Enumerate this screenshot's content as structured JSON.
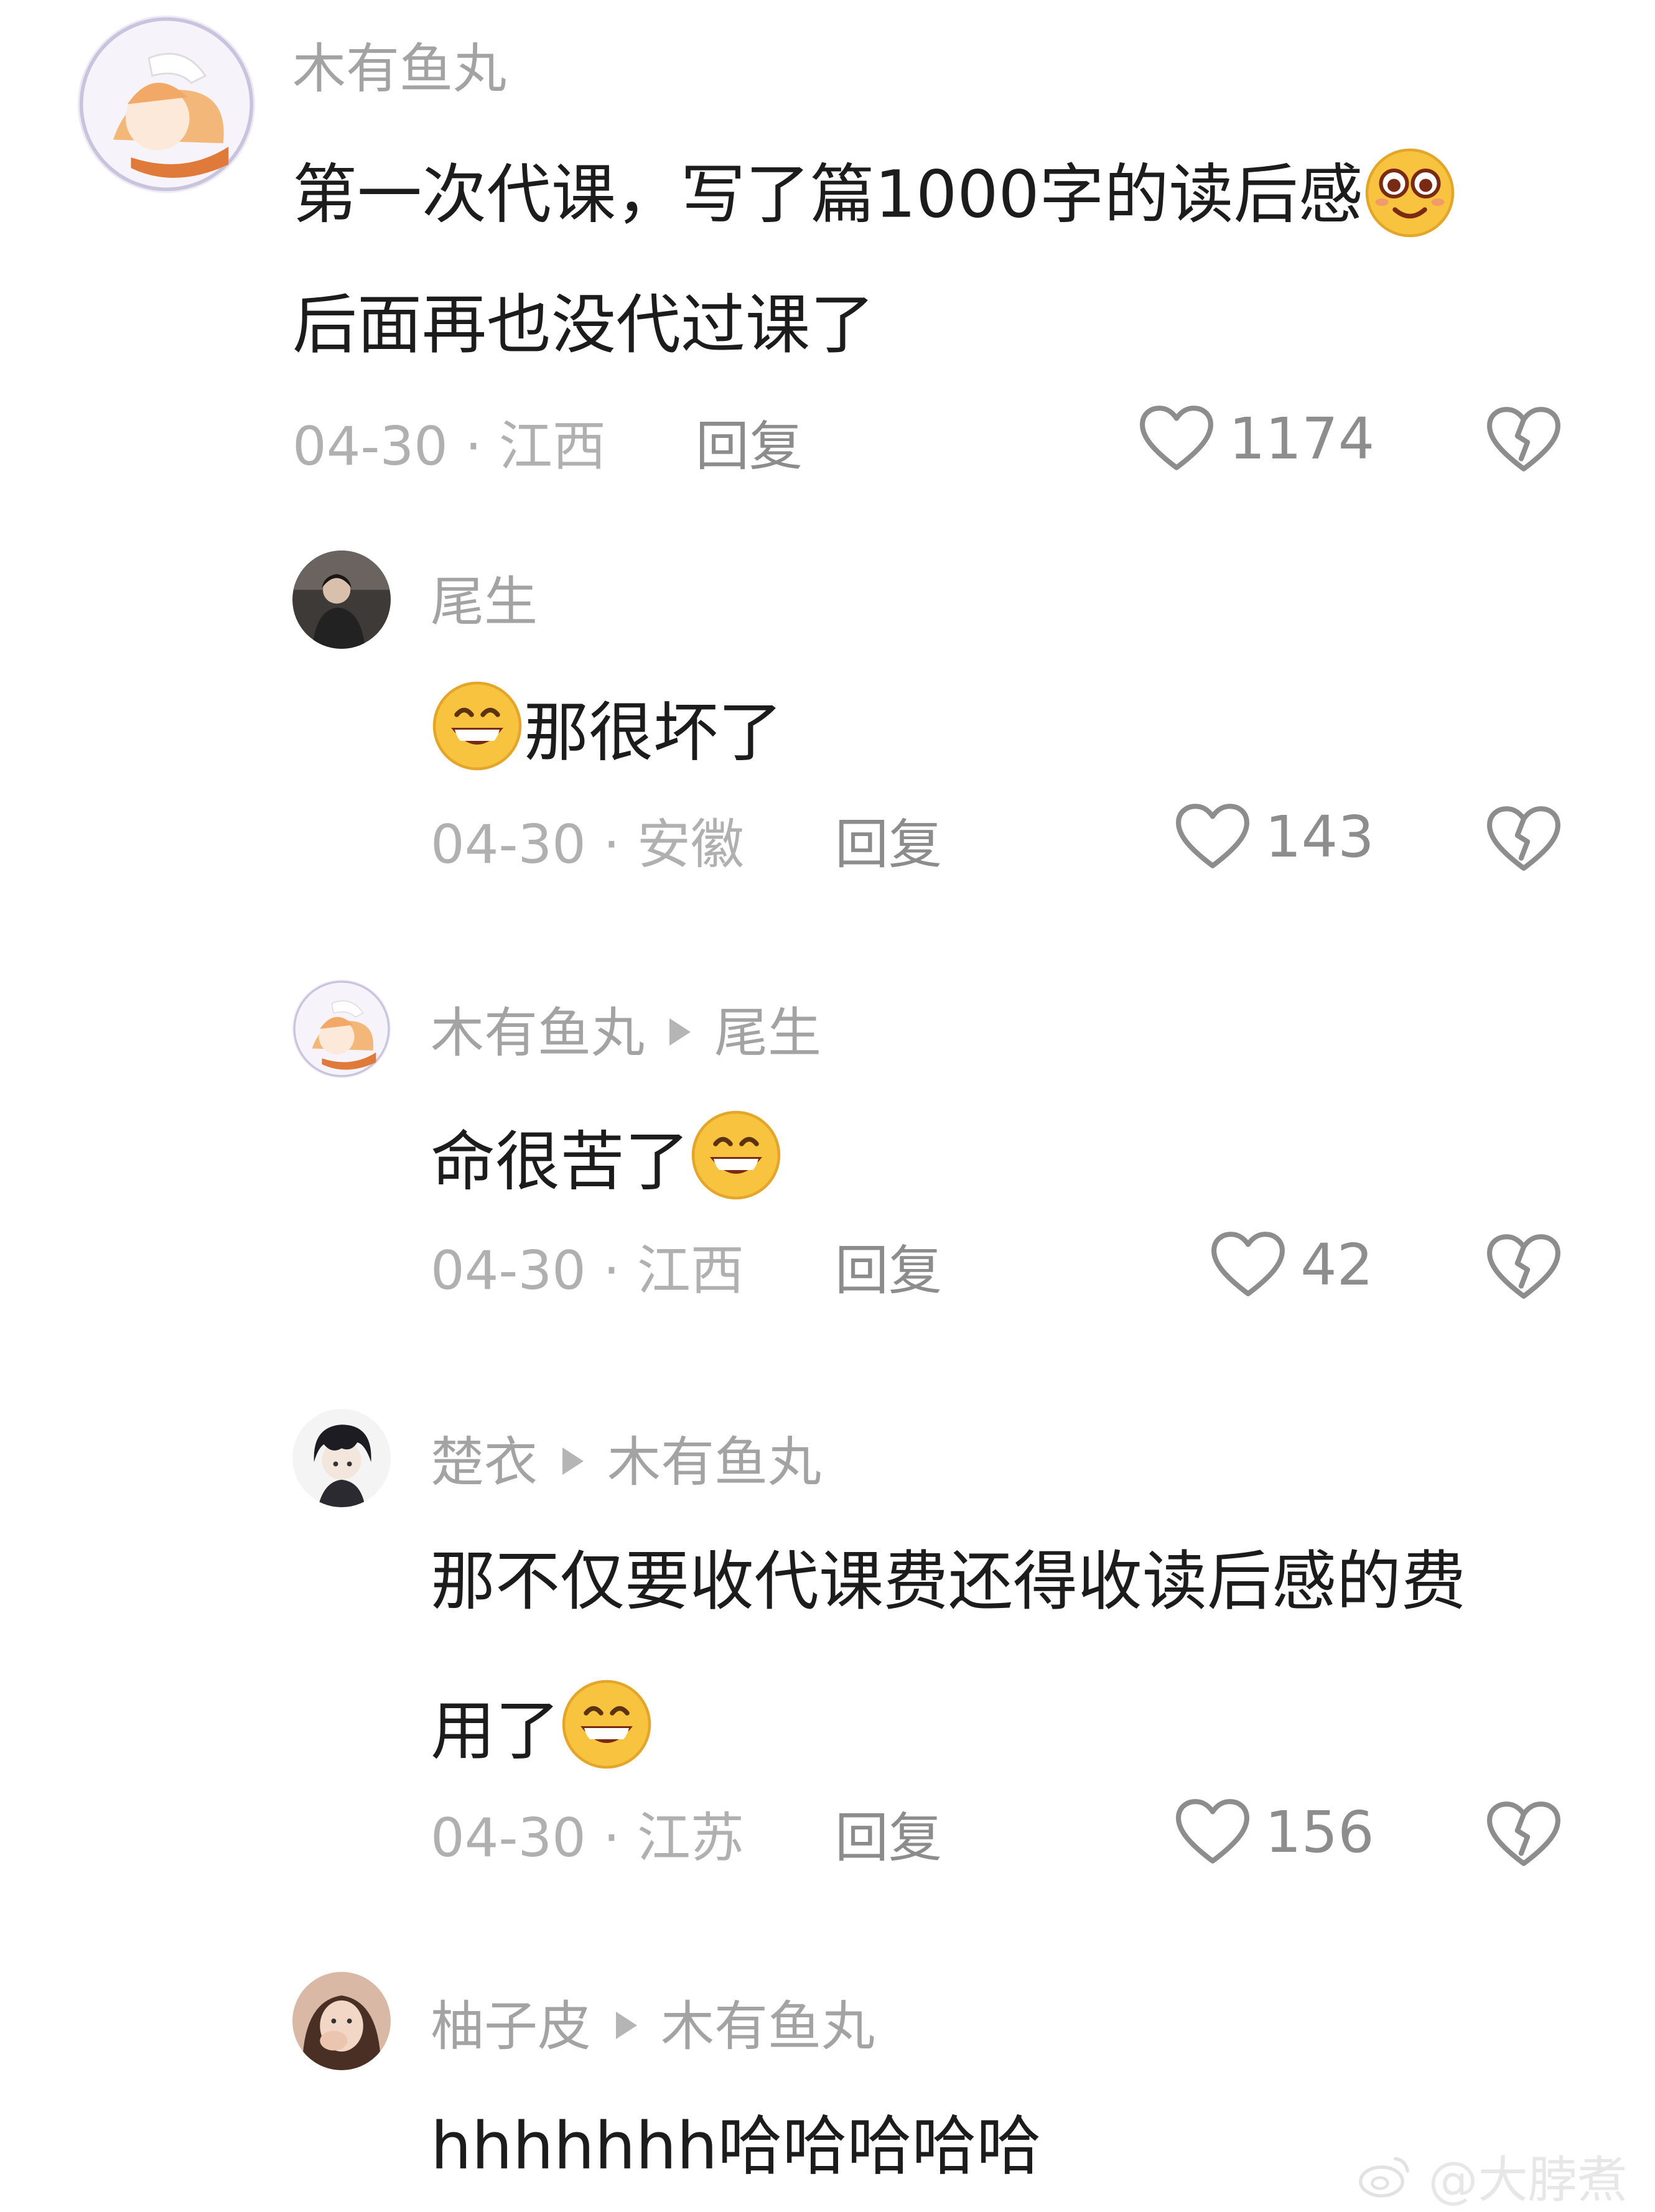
{
  "comments": [
    {
      "author": "木有鱼丸",
      "content_line1": "第一次代课，写了篇1000字的读后感",
      "content_line2": "后面再也没代过课了",
      "date_location": "04-30 · 江西",
      "reply_label": "回复",
      "likes": "1174"
    },
    {
      "author": "尾生",
      "content": "那很坏了",
      "date_location": "04-30 · 安徽",
      "reply_label": "回复",
      "likes": "143"
    },
    {
      "author": "木有鱼丸",
      "reply_to": "尾生",
      "content": "命很苦了",
      "date_location": "04-30 · 江西",
      "reply_label": "回复",
      "likes": "42"
    },
    {
      "author": "楚衣",
      "reply_to": "木有鱼丸",
      "content_line1": "那不仅要收代课费还得收读后感的费",
      "content_line2": "用了",
      "date_location": "04-30 · 江苏",
      "reply_label": "回复",
      "likes": "156"
    },
    {
      "author": "柚子皮",
      "reply_to": "木有鱼丸",
      "content": "hhhhhhh哈哈哈哈哈"
    }
  ],
  "watermark": "@大脖煮",
  "icons": {
    "like": "heart-outline-icon",
    "dislike": "broken-heart-icon",
    "reply_arrow": "triangle-right-icon",
    "emoji_grin": "grinning-face-emoji",
    "emoji_eyes": "wide-eyed-smile-emoji",
    "watermark_logo": "weibo-logo-icon"
  },
  "colors": {
    "background": "#ffffff",
    "username": "#a3a3a3",
    "content": "#1c1c1c",
    "meta": "#b0b0b0",
    "icon": "#8d8d8d"
  }
}
